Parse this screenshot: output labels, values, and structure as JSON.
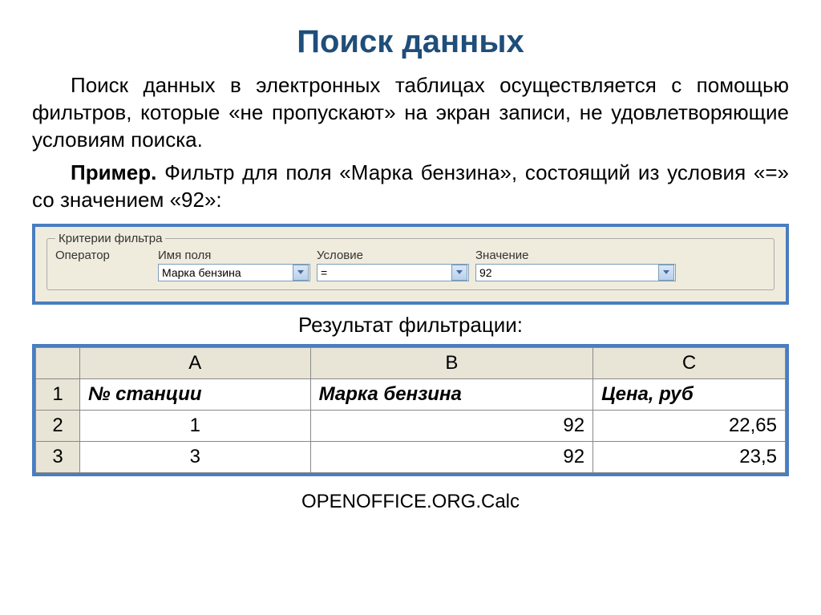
{
  "title": "Поиск данных",
  "para1": "Поиск данных в электронных таблицах осуществляется с помощью фильтров, которые «не пропускают» на экран записи, не удовлетворяющие условиям поиска.",
  "para2_label": "Пример.",
  "para2_text": " Фильтр для поля «Марка бензина», состоящий из условия «=» со значением «92»:",
  "filter": {
    "legend": "Критерии фильтра",
    "headers": {
      "op": "Оператор",
      "name": "Имя поля",
      "cond": "Условие",
      "val": "Значение"
    },
    "values": {
      "op": "",
      "name": "Марка бензина",
      "cond": "=",
      "val": "92"
    }
  },
  "result_label": "Результат фильтрации:",
  "sheet": {
    "cols": [
      "A",
      "B",
      "C"
    ],
    "rowheads": [
      "1",
      "2",
      "3"
    ],
    "header_row": [
      "№ станции",
      "Марка бензина",
      "Цена, руб"
    ],
    "rows": [
      [
        "1",
        "92",
        "22,65"
      ],
      [
        "3",
        "92",
        "23,5"
      ]
    ]
  },
  "footer": "OPENOFFICE.ORG.Calc"
}
